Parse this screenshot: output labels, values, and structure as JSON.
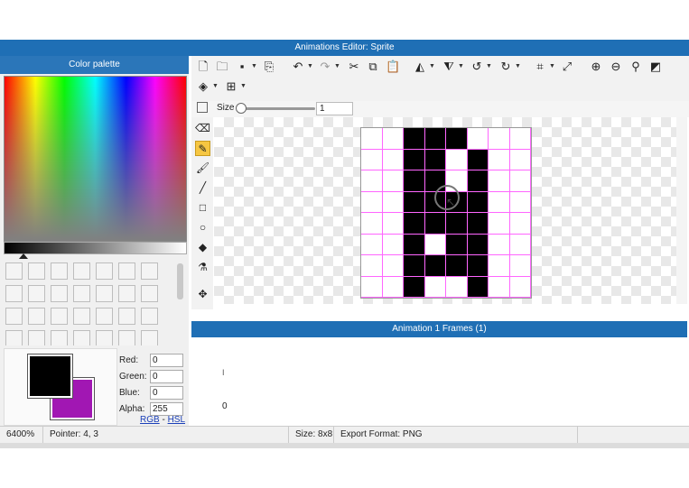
{
  "window": {
    "title": "Animations Editor: Sprite"
  },
  "palette": {
    "title": "Color palette",
    "primary_color": "#000000",
    "secondary_color": "#a117b3",
    "fields": [
      {
        "label": "Red:",
        "value": "0"
      },
      {
        "label": "Green:",
        "value": "0"
      },
      {
        "label": "Blue:",
        "value": "0"
      },
      {
        "label": "Alpha:",
        "value": "255"
      }
    ],
    "links": {
      "rgb": "RGB",
      "separator": " - ",
      "hsl": "HSL"
    }
  },
  "toolbar": {
    "icons": [
      "new-file-icon",
      "open-folder-icon",
      "save-icon",
      "export-icon",
      "undo-icon",
      "redo-icon",
      "cut-icon",
      "copy-icon",
      "paste-icon",
      "flip-horizontal-icon",
      "flip-vertical-icon",
      "rotate-left-icon",
      "rotate-right-icon",
      "crop-icon",
      "resize-icon",
      "zoom-in-icon",
      "zoom-out-icon",
      "zoom-fit-icon",
      "zoom-actual-icon",
      "layers-icon",
      "grid-icon"
    ]
  },
  "size": {
    "label": "Size",
    "value": "1"
  },
  "tools": [
    "eraser-icon",
    "pencil-icon",
    "brush-icon",
    "line-icon",
    "rectangle-icon",
    "ellipse-icon",
    "fill-bucket-icon",
    "eyedropper-icon",
    "move-icon"
  ],
  "active_tool": "pencil-icon",
  "sprite": {
    "grid": 8,
    "pixels": [
      "00111000",
      "00110100",
      "00110100",
      "00111100",
      "00111100",
      "00101100",
      "00111100",
      "00100100"
    ]
  },
  "frames": {
    "title": "Animation 1 Frames (1)",
    "marker": "I",
    "frame_index": "0"
  },
  "status": {
    "zoom": "6400%",
    "pointer": "Pointer: 4, 3",
    "size": "Size: 8x8",
    "export": "Export Format: PNG"
  }
}
